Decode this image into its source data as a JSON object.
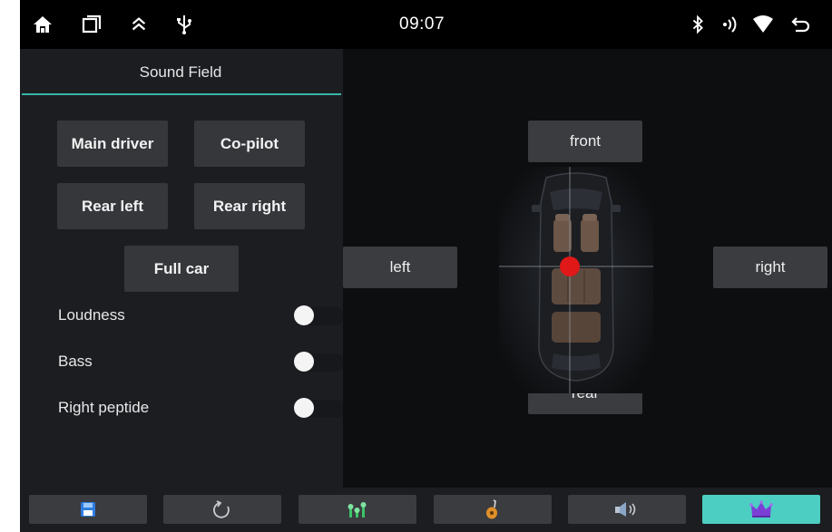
{
  "status_bar": {
    "time": "09:07",
    "left_icons": [
      "home-icon",
      "recent-apps-icon",
      "chevron-up-icon",
      "usb-icon"
    ],
    "right_icons": [
      "bluetooth-icon",
      "cast-icon",
      "wifi-icon",
      "back-icon"
    ]
  },
  "sound_field": {
    "tab_title": "Sound Field",
    "zones": {
      "main_driver": "Main driver",
      "co_pilot": "Co-pilot",
      "rear_left": "Rear left",
      "rear_right": "Rear right",
      "full_car": "Full car"
    },
    "toggles": [
      {
        "label": "Loudness",
        "on": false
      },
      {
        "label": "Bass",
        "on": false
      },
      {
        "label": "Right peptide",
        "on": false
      }
    ]
  },
  "balance": {
    "front": "front",
    "rear": "rear",
    "left": "left",
    "right": "right",
    "marker_color": "#e01818"
  },
  "bottom_bar": {
    "tabs": [
      {
        "icon": "save-icon",
        "active": false
      },
      {
        "icon": "reset-icon",
        "active": false
      },
      {
        "icon": "equalizer-icon",
        "active": false
      },
      {
        "icon": "instrument-icon",
        "active": false
      },
      {
        "icon": "speaker-icon",
        "active": false
      },
      {
        "icon": "crown-icon",
        "active": true
      }
    ],
    "accent_color": "#4ccfc2"
  }
}
